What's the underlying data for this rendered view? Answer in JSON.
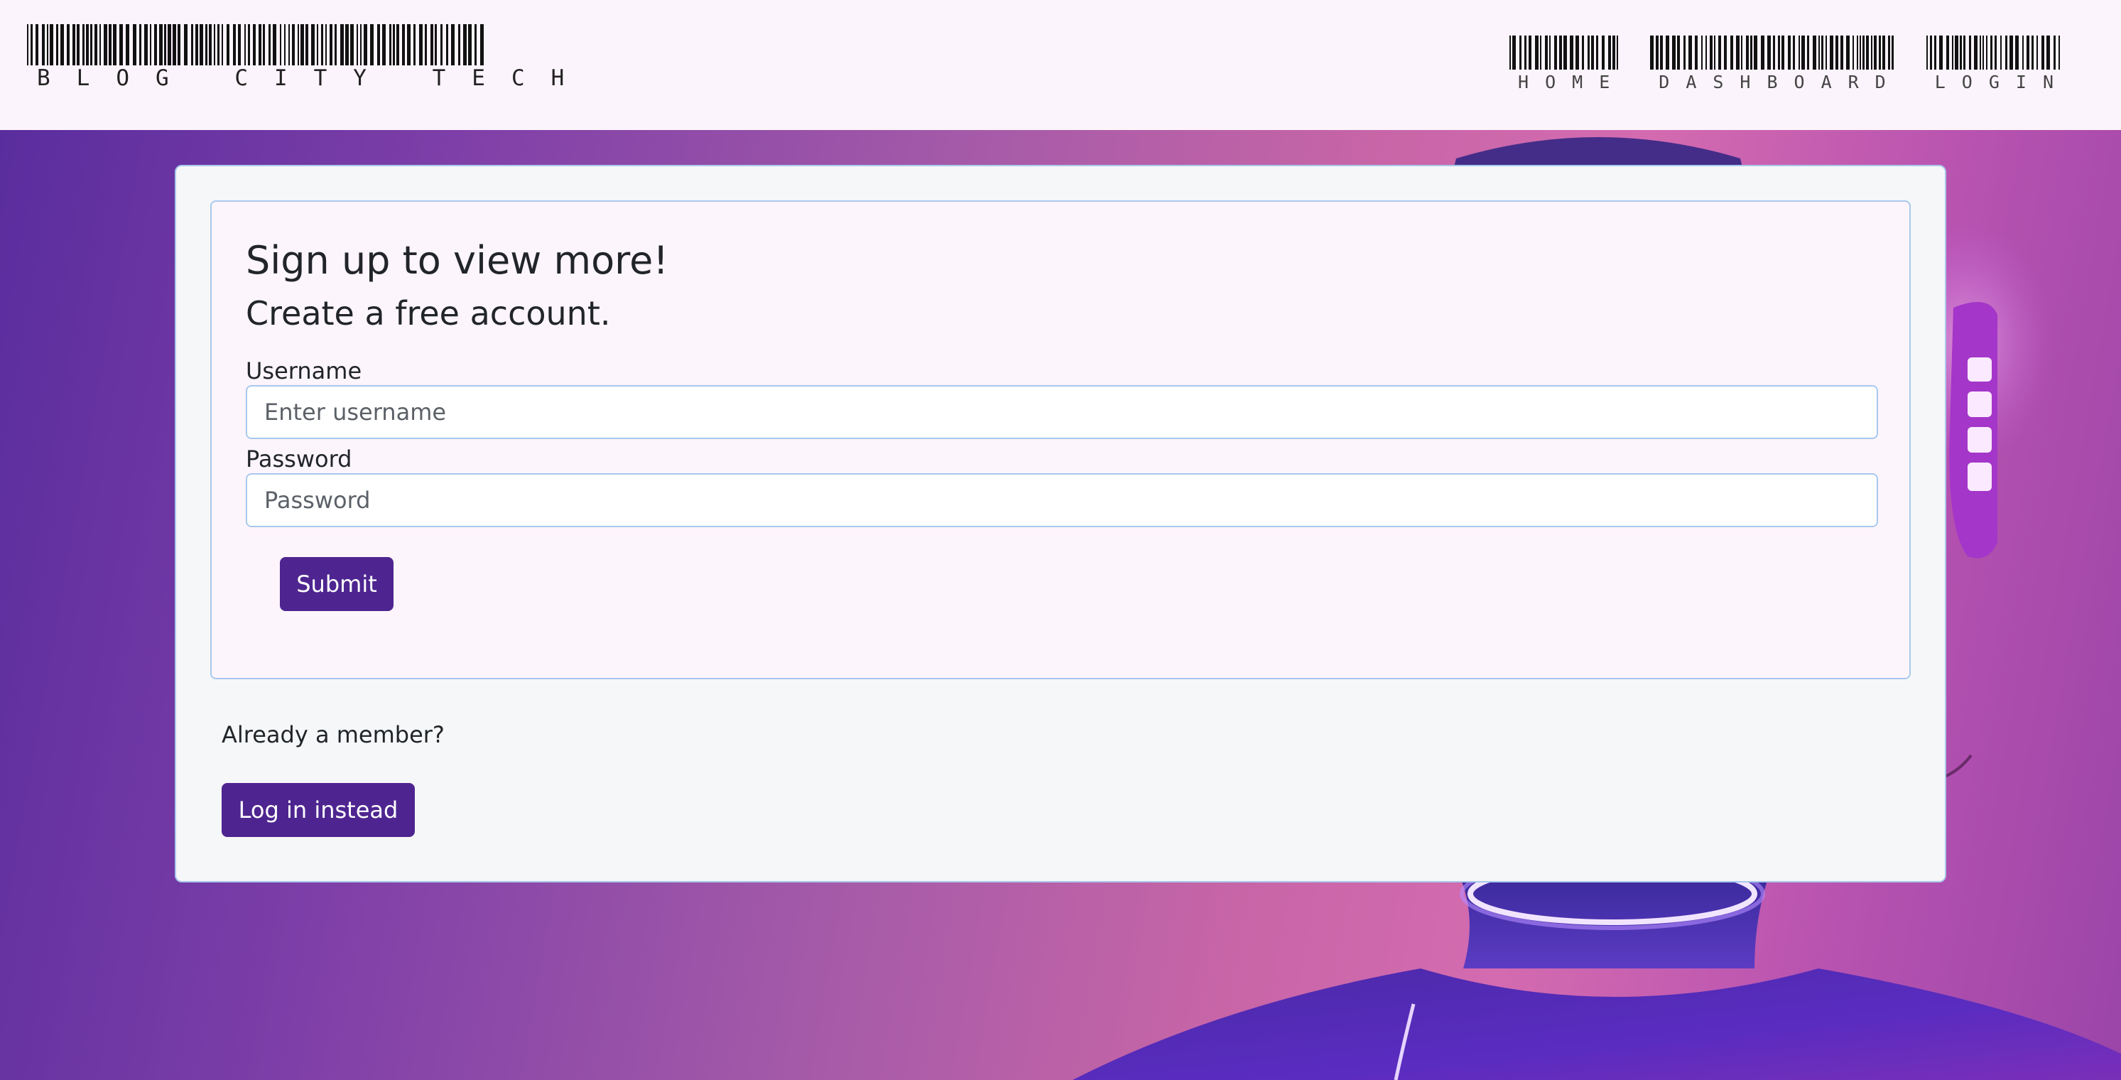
{
  "brand": {
    "name": "BLOG CITY TECH"
  },
  "nav": {
    "items": [
      {
        "label": "HOME"
      },
      {
        "label": "DASHBOARD"
      },
      {
        "label": "LOGIN"
      }
    ]
  },
  "signup": {
    "title": "Sign up to view more!",
    "subtitle": "Create a free account.",
    "username_label": "Username",
    "username_placeholder": "Enter username",
    "username_value": "",
    "password_label": "Password",
    "password_placeholder": "Password",
    "password_value": "",
    "submit_label": "Submit"
  },
  "login_prompt": {
    "text": "Already a member?",
    "button_label": "Log in instead"
  },
  "colors": {
    "accent": "#4e2590",
    "border": "#a9c8ec",
    "header_bg": "#fcf4fc",
    "card_bg": "#f6f7f8"
  },
  "icons": {
    "brand_logo": "barcode-logo",
    "nav": "barcode"
  }
}
